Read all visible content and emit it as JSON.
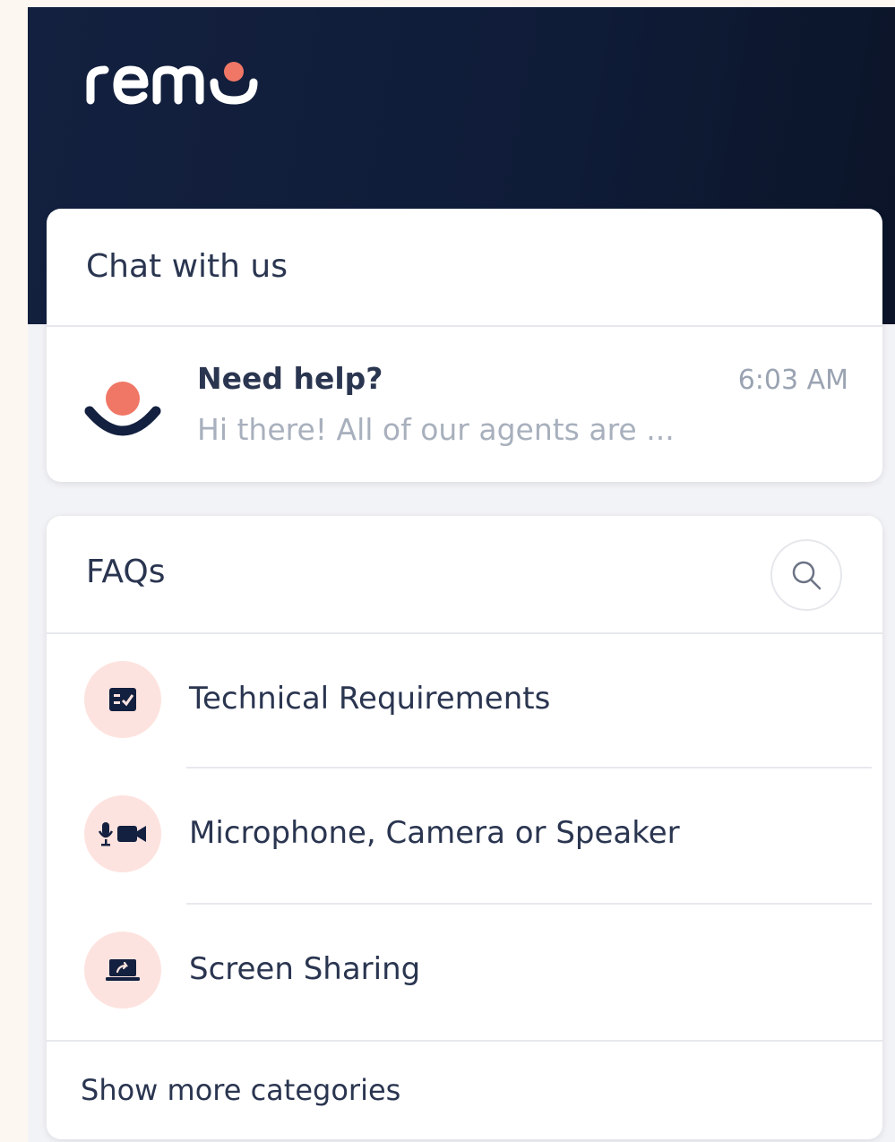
{
  "brand": {
    "name": "remo",
    "accent": "#f07766",
    "header_bg": "#13203f"
  },
  "chat_card": {
    "title": "Chat with us",
    "conversation": {
      "name": "Need help?",
      "time": "6:03 AM",
      "preview": "Hi there! All of our agents are ..."
    }
  },
  "faq_card": {
    "title": "FAQs",
    "search_icon": "search-icon",
    "categories": [
      {
        "label": "Technical Requirements",
        "icon": "checklist-icon"
      },
      {
        "label": "Microphone, Camera or Speaker",
        "icon": "mic-camera-icon"
      },
      {
        "label": "Screen Sharing",
        "icon": "screen-share-icon"
      }
    ],
    "show_more": "Show more categories"
  }
}
